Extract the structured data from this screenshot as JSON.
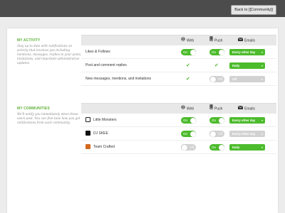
{
  "header": {
    "back_button_label": "Back to [[Community]]"
  },
  "columns": {
    "web": "Web",
    "push": "Push",
    "emails": "Emails"
  },
  "activity": {
    "title": "MY ACTIVITY",
    "description": "Stay up to date with notifications on activity that involves you including mentions, messages, replies to your posts, invitations, and important administrative updates.",
    "rows": [
      {
        "label": "Likes & Follows",
        "web": "On",
        "push": "On",
        "email": "Every other day"
      },
      {
        "label": "Post and comment replies",
        "web_check": "✔",
        "push_check": "✔",
        "email": "Daily"
      },
      {
        "label": "New messages, mentions, and invitations",
        "web_check": "✔",
        "push": "Off",
        "email": "Off"
      }
    ]
  },
  "communities": {
    "title": "MY COMMUNITIES",
    "description": "We'll notify you immediately when these users post. You can fine-tune how you get notifications from each community.",
    "rows": [
      {
        "label": "Little Monsters",
        "web": "On",
        "push": "On",
        "email": "Every other day"
      },
      {
        "label": "DJ SKEE",
        "web": "On",
        "push": "Off",
        "email": "Every other day"
      },
      {
        "label": "Team Crafted",
        "web": "Off",
        "push": "On",
        "email": "Daily"
      }
    ]
  },
  "colors": {
    "accent": "#4cbb2c",
    "title_green": "#62b33b",
    "off": "#d2d2d2",
    "topbar": "#4c4c4c"
  },
  "icons": {
    "web": "globe-icon",
    "push": "phone-icon",
    "emails": "envelope-icon",
    "dropdown": "caret-down-icon"
  }
}
